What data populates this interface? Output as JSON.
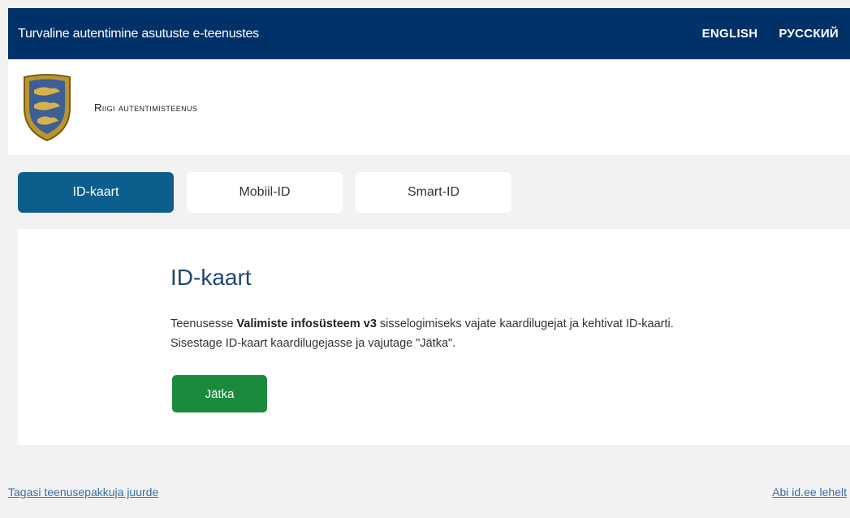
{
  "header": {
    "title": "Turvaline autentimine asutuste e-teenustes",
    "languages": [
      "ENGLISH",
      "РУССКИЙ"
    ]
  },
  "brand": {
    "name": "Riigi autentimisteenus",
    "crest_icon": "estonian-coat-of-arms-icon"
  },
  "tabs": [
    {
      "label": "ID-kaart",
      "active": true
    },
    {
      "label": "Mobiil-ID",
      "active": false
    },
    {
      "label": "Smart-ID",
      "active": false
    }
  ],
  "panel": {
    "heading": "ID-kaart",
    "text_before": "Teenusesse ",
    "service_name": "Valimiste infosüsteem v3",
    "text_after": " sisselogimiseks vajate kaardilugejat ja kehtivat ID-kaarti.",
    "line2": "Sisestage ID-kaart kaardilugejasse ja vajutage \"Jätka\".",
    "continue_label": "Jätka"
  },
  "footer": {
    "back_link": "Tagasi teenusepakkuja juurde",
    "help_link": "Abi id.ee lehelt"
  },
  "colors": {
    "header_bg": "#003168",
    "tab_active": "#0c5e8c",
    "button": "#1b8a3d",
    "heading": "#1d4771",
    "link": "#386fa4"
  }
}
